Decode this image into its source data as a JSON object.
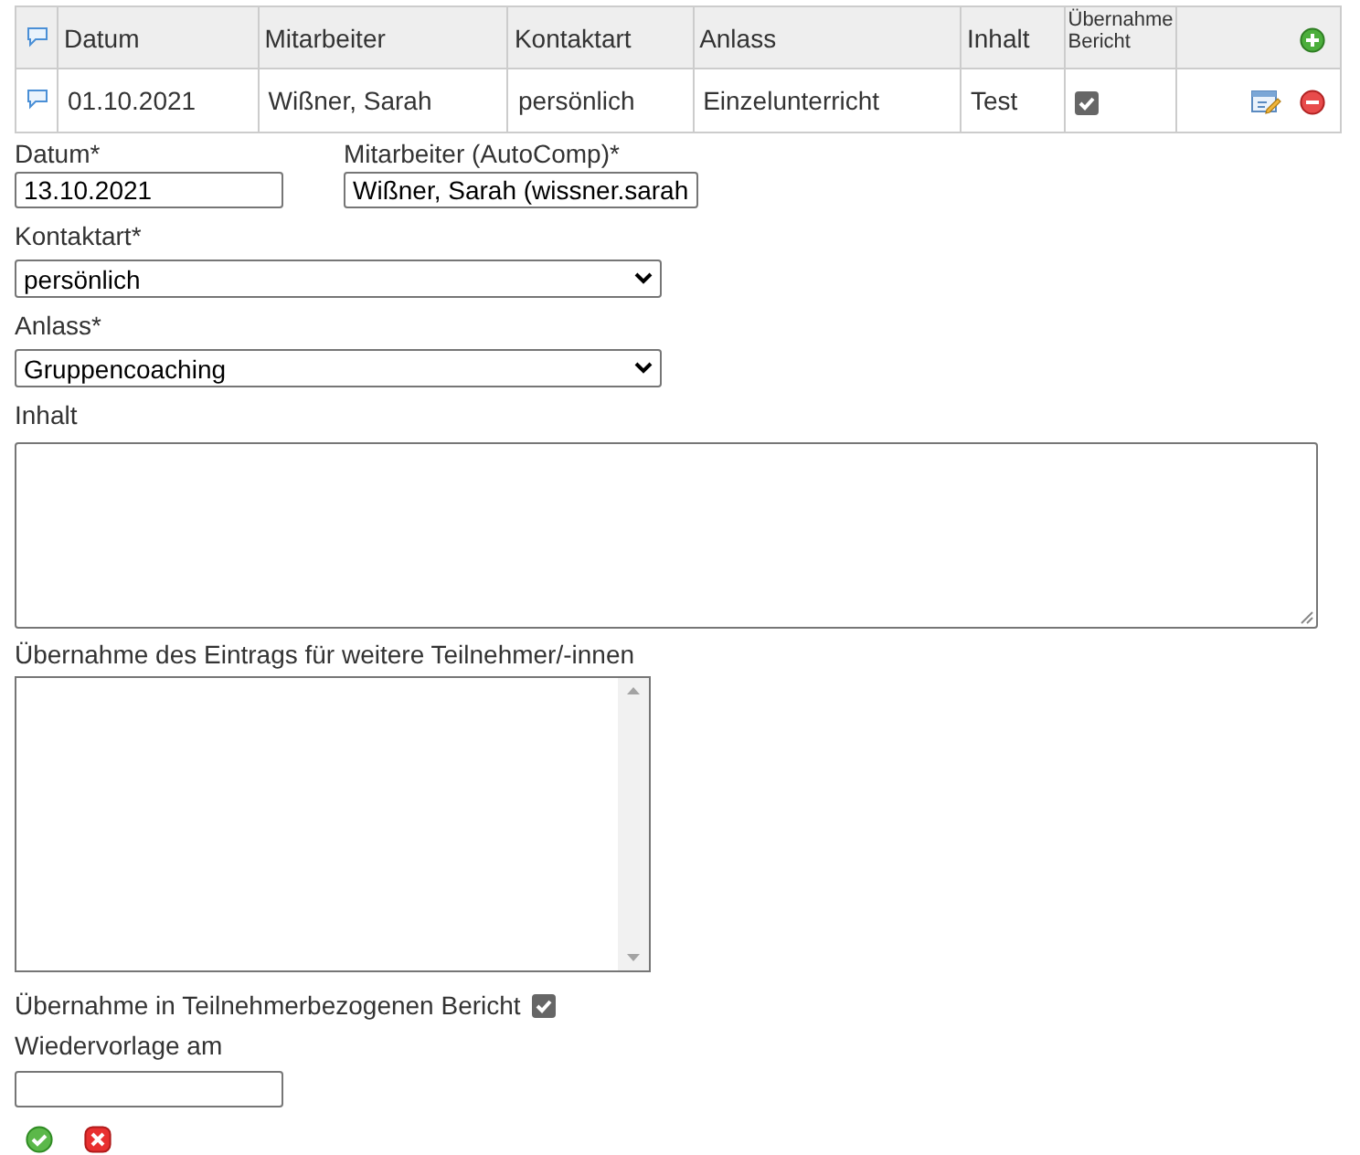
{
  "table": {
    "columns": [
      "Datum",
      "Mitarbeiter",
      "Kontaktart",
      "Anlass",
      "Inhalt",
      "Übernahme Bericht"
    ],
    "rows": [
      {
        "datum": "01.10.2021",
        "mitarbeiter": "Wißner, Sarah",
        "kontaktart": "persönlich",
        "anlass": "Einzelunterricht",
        "inhalt": "Test",
        "uebernahme_bericht": true
      }
    ]
  },
  "form": {
    "datum": {
      "label": "Datum*",
      "value": "13.10.2021"
    },
    "mitarbeiter": {
      "label": "Mitarbeiter (AutoComp)*",
      "value": "Wißner, Sarah (wissner.sarah"
    },
    "kontaktart": {
      "label": "Kontaktart*",
      "value": "persönlich"
    },
    "anlass": {
      "label": "Anlass*",
      "value": "Gruppencoaching"
    },
    "inhalt": {
      "label": "Inhalt"
    },
    "weitere": {
      "label": "Übernahme des Eintrags für weitere Teilnehmer/-innen"
    },
    "bericht": {
      "label": "Übernahme in Teilnehmerbezogenen Bericht",
      "checked": true
    },
    "wiedervorlage": {
      "label": "Wiedervorlage am"
    }
  }
}
